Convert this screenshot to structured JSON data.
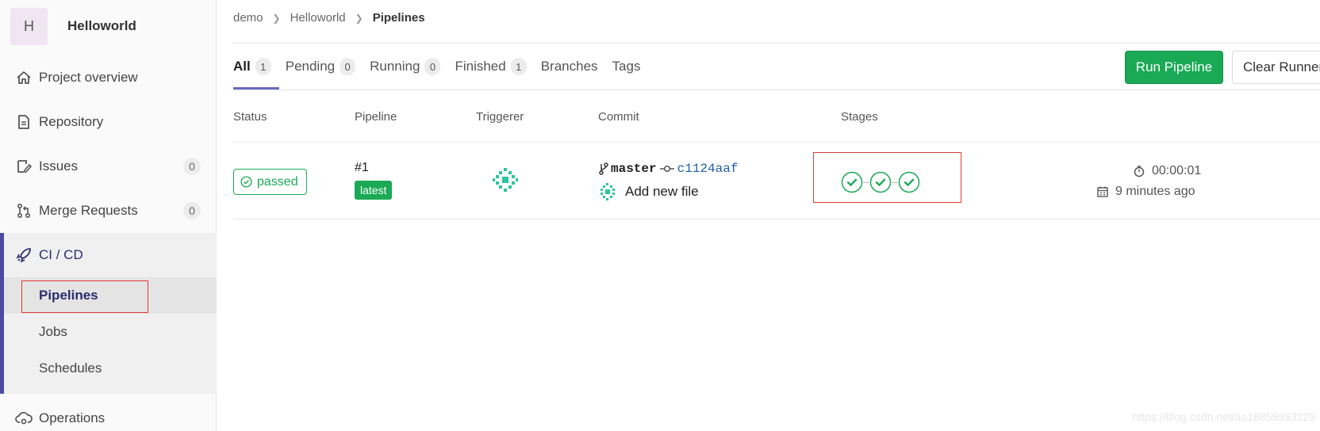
{
  "project": {
    "avatar_letter": "H",
    "name": "Helloworld"
  },
  "sidebar": {
    "items": [
      {
        "label": "Project overview",
        "icon": "home-icon"
      },
      {
        "label": "Repository",
        "icon": "document-icon"
      },
      {
        "label": "Issues",
        "icon": "issues-icon",
        "count": "0"
      },
      {
        "label": "Merge Requests",
        "icon": "merge-request-icon",
        "count": "0"
      }
    ],
    "cicd": {
      "label": "CI / CD",
      "icon": "rocket-icon",
      "subitems": [
        {
          "label": "Pipelines",
          "active": true
        },
        {
          "label": "Jobs"
        },
        {
          "label": "Schedules"
        }
      ]
    },
    "operations": {
      "label": "Operations",
      "icon": "cloud-gear-icon"
    }
  },
  "breadcrumb": {
    "items": [
      "demo",
      "Helloworld"
    ],
    "current": "Pipelines"
  },
  "tabs": [
    {
      "label": "All",
      "count": "1",
      "active": true
    },
    {
      "label": "Pending",
      "count": "0"
    },
    {
      "label": "Running",
      "count": "0"
    },
    {
      "label": "Finished",
      "count": "1"
    },
    {
      "label": "Branches"
    },
    {
      "label": "Tags"
    }
  ],
  "actions": {
    "run_pipeline": "Run Pipeline",
    "clear_runner": "Clear Runner Caches"
  },
  "table": {
    "headers": {
      "status": "Status",
      "pipeline": "Pipeline",
      "triggerer": "Triggerer",
      "commit": "Commit",
      "stages": "Stages"
    },
    "row": {
      "status": "passed",
      "pipeline_id": "#1",
      "pipeline_badge": "latest",
      "branch": "master",
      "sha": "c1124aaf",
      "commit_message": "Add new file",
      "stages": [
        "passed",
        "passed",
        "passed"
      ],
      "duration": "00:00:01",
      "finished_ago": "9 minutes ago"
    }
  },
  "watermark": "https://blog.csdn.net/aa18855953229",
  "colors": {
    "success": "#1aaa55",
    "accent": "#4b4ba3",
    "link": "#1f5fa8",
    "highlight_box": "#e53935"
  }
}
